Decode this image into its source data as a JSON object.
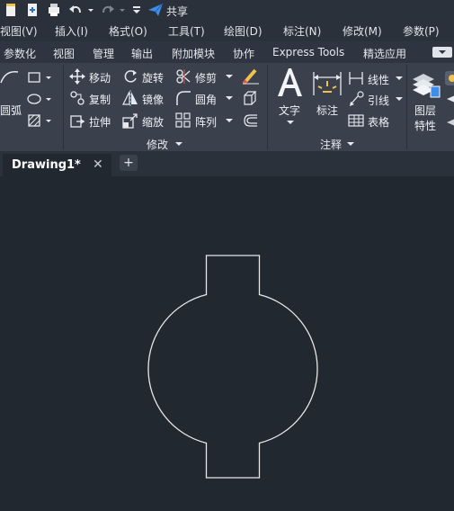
{
  "qat": {
    "share_label": "共享"
  },
  "menubar": {
    "items": [
      "视图(V)",
      "插入(I)",
      "格式(O)",
      "工具(T)",
      "绘图(D)",
      "标注(N)",
      "修改(M)",
      "参数(P)"
    ]
  },
  "ribbon_tabs": [
    "参数化",
    "视图",
    "管理",
    "输出",
    "附加模块",
    "协作",
    "Express Tools",
    "精选应用"
  ],
  "draw_panel": {
    "arc_label": "圆弧"
  },
  "modify_panel": {
    "title": "修改",
    "items": {
      "move": "移动",
      "rotate": "旋转",
      "trim": "修剪",
      "copy": "复制",
      "mirror": "镜像",
      "fillet": "圆角",
      "stretch": "拉伸",
      "scale": "缩放",
      "array": "阵列"
    }
  },
  "annotation_panel": {
    "title": "注释",
    "text_label": "文字",
    "dimension_label": "标注",
    "linear_label": "线性",
    "leader_label": "引线",
    "table_label": "表格"
  },
  "layers_panel": {
    "label_line1": "图层",
    "label_line2": "特性"
  },
  "document": {
    "tab_title": "Drawing1*",
    "close_glyph": "✕",
    "new_tab_glyph": "+"
  },
  "colors": {
    "background": "#212830",
    "ribbon": "#3a414d",
    "shape_stroke": "#e8e8e8"
  }
}
